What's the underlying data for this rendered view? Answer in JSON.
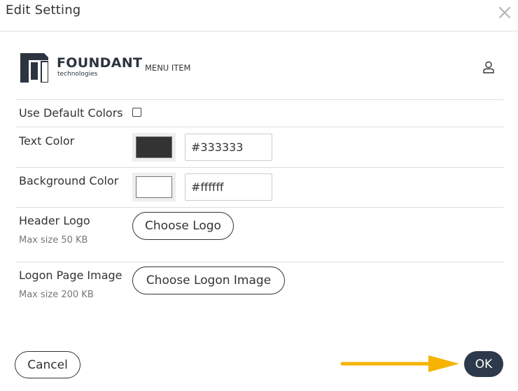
{
  "dialog": {
    "title": "Edit Setting",
    "close_icon": "close-icon"
  },
  "preview": {
    "brand_name": "FOUNDANT",
    "brand_sub": "technologies",
    "menu_item": "MENU ITEM",
    "user_icon": "user-icon"
  },
  "settings": {
    "use_default_colors": {
      "label": "Use Default Colors",
      "checked": false
    },
    "text_color": {
      "label": "Text Color",
      "value": "#333333",
      "swatch": "#333333"
    },
    "background_color": {
      "label": "Background Color",
      "value": "#ffffff",
      "swatch": "#ffffff"
    },
    "header_logo": {
      "label": "Header Logo",
      "hint": "Max size 50 KB",
      "button": "Choose Logo"
    },
    "logon_image": {
      "label": "Logon Page Image",
      "hint": "Max size 200 KB",
      "button": "Choose Logon Image"
    }
  },
  "footer": {
    "cancel_label": "Cancel",
    "ok_label": "OK",
    "arrow_color": "#f5b400"
  },
  "colors": {
    "primary_dark": "#2d3a4b",
    "divider": "#dddddd"
  }
}
